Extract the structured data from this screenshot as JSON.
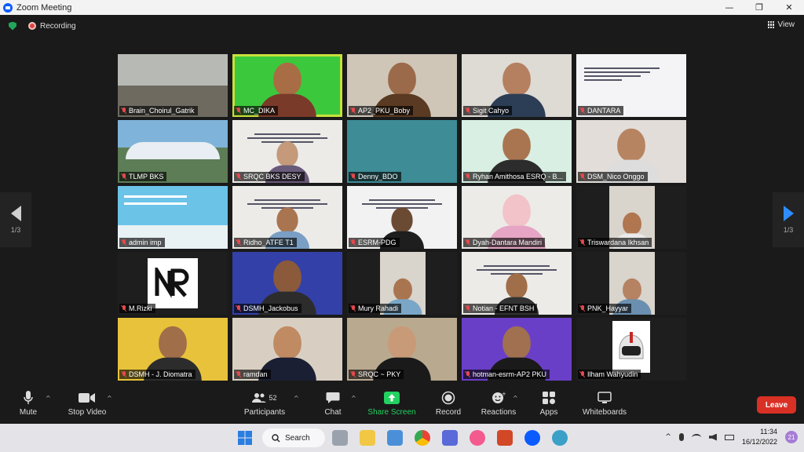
{
  "window": {
    "title": "Zoom Meeting",
    "minimize": "—",
    "maximize": "❐",
    "close": "✕"
  },
  "topbar": {
    "recording_label": "Recording",
    "view_label": "View"
  },
  "pagination": {
    "left_page": "1/3",
    "right_page": "1/3"
  },
  "participants": [
    {
      "name": "Brain_Choirul_Gatrik",
      "muted": true,
      "bg": "#8a8f8c",
      "kind": "room"
    },
    {
      "name": "MC_DIKA",
      "muted": true,
      "bg": "#3cc83c",
      "kind": "person",
      "skin": "#a86d44",
      "shirt": "#7a3a2a",
      "active": true
    },
    {
      "name": "AP2_PKU_Boby",
      "muted": true,
      "bg": "#cfc6b8",
      "kind": "person",
      "skin": "#9a6a4a",
      "shirt": "#5a3a22"
    },
    {
      "name": "Sigit Cahyo",
      "muted": true,
      "bg": "#dedad4",
      "kind": "person",
      "skin": "#b58060",
      "shirt": "#2c3e55"
    },
    {
      "name": "DANTARA",
      "muted": true,
      "bg": "#f4f4f6",
      "kind": "slide"
    },
    {
      "name": "TLMP BKS",
      "muted": true,
      "bg": "#7fb3d9",
      "kind": "building"
    },
    {
      "name": "SRQC BKS DESY",
      "muted": true,
      "bg": "#ecebe8",
      "kind": "slide-person",
      "skin": "#c49a7a",
      "shirt": "#6a5a7a"
    },
    {
      "name": "Denny_BDO",
      "muted": true,
      "bg": "#3d8c96",
      "kind": "plain"
    },
    {
      "name": "Ryhan Amithosa ESRQ - B...",
      "muted": true,
      "bg": "#d9efe4",
      "kind": "person",
      "skin": "#a97550",
      "shirt": "#2c2c2c"
    },
    {
      "name": "DSM_Nico Onggo",
      "muted": true,
      "bg": "#e2ddd8",
      "kind": "person",
      "skin": "#b78462",
      "shirt": "#ddd"
    },
    {
      "name": "admin imp",
      "muted": true,
      "bg": "#6cc3e8",
      "kind": "banner"
    },
    {
      "name": "Ridho_ATFE T1",
      "muted": true,
      "bg": "#ecebe8",
      "kind": "slide-person",
      "skin": "#a97550",
      "shirt": "#7a9ec4"
    },
    {
      "name": "ESRM-PDG",
      "muted": true,
      "bg": "#f2f2f2",
      "kind": "slide-person",
      "skin": "#6b4a34",
      "shirt": "#1e1e1e"
    },
    {
      "name": "Dyah-Dantara Mandiri",
      "muted": true,
      "bg": "#ecebe8",
      "kind": "person",
      "skin": "#f2c3c8",
      "shirt": "#e6a5c4"
    },
    {
      "name": "Triswardana Ikhsan",
      "muted": true,
      "bg": "#1e1e1e",
      "kind": "inset",
      "skin": "#b07650",
      "shirt": "#e9e9e9"
    },
    {
      "name": "M.Rizki",
      "muted": true,
      "bg": "#1e1e1e",
      "kind": "logo"
    },
    {
      "name": "DSMH_Jackobus",
      "muted": true,
      "bg": "#3340a8",
      "kind": "person",
      "skin": "#8a5a3a",
      "shirt": "#2c2c2c"
    },
    {
      "name": "Mury Rahadi",
      "muted": true,
      "bg": "#1e1e1e",
      "kind": "inset",
      "skin": "#a97550",
      "shirt": "#7aa7c7"
    },
    {
      "name": "Notian - EFNT BSH",
      "muted": true,
      "bg": "#ecebe8",
      "kind": "slide-person",
      "skin": "#a06e48",
      "shirt": "#333"
    },
    {
      "name": "PNK_Hayyar",
      "muted": true,
      "bg": "#1e1e1e",
      "kind": "inset",
      "skin": "#b58262",
      "shirt": "#6a8fb0"
    },
    {
      "name": "DSMH - J. Diomatra",
      "muted": true,
      "bg": "#e8c23a",
      "kind": "person",
      "skin": "#a06e48",
      "shirt": "#2c2c2c"
    },
    {
      "name": "ramdan",
      "muted": true,
      "bg": "#d8cfc2",
      "kind": "person",
      "skin": "#c08a62",
      "shirt": "#1a1f33"
    },
    {
      "name": "SRQC ~ PKY",
      "muted": true,
      "bg": "#b9a98f",
      "kind": "person",
      "skin": "#c89a78",
      "shirt": "#1a1a1a"
    },
    {
      "name": "hotman-esrm-AP2 PKU",
      "muted": true,
      "bg": "#6a3fc8",
      "kind": "person",
      "skin": "#a07050",
      "shirt": "#1a1a1a"
    },
    {
      "name": "Ilham Wahyudin",
      "muted": true,
      "bg": "#1e1e1e",
      "kind": "helmet"
    }
  ],
  "toolbar": {
    "mute": "Mute",
    "stop_video": "Stop Video",
    "participants": "Participants",
    "participants_count": "52",
    "chat": "Chat",
    "share_screen": "Share Screen",
    "record": "Record",
    "reactions": "Reactions",
    "apps": "Apps",
    "whiteboards": "Whiteboards",
    "leave": "Leave"
  },
  "taskbar": {
    "search_label": "Search",
    "time": "11:34",
    "date": "16/12/2022",
    "notification_count": "21"
  },
  "colors": {
    "active_speaker": "#c7e13c",
    "leave": "#d93025",
    "share_green": "#23d160",
    "zoom_blue": "#0b5cff"
  }
}
